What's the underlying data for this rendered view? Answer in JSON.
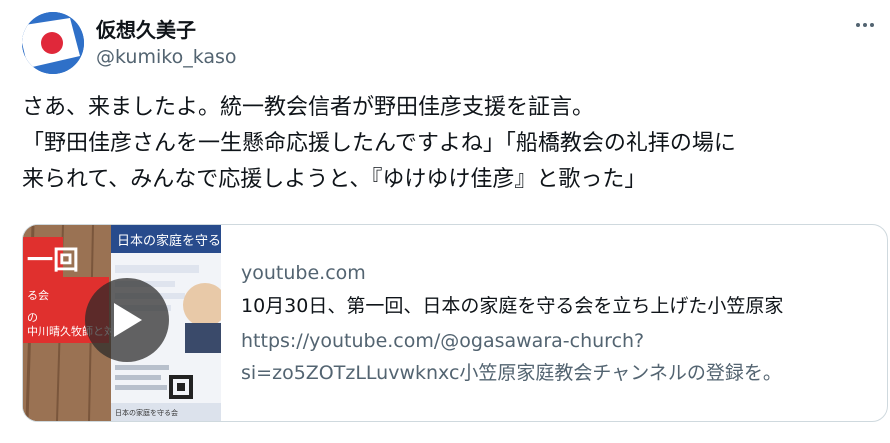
{
  "user": {
    "display_name": "仮想久美子",
    "handle": "@kumiko_kaso",
    "avatar_icon": "japan-flag-avatar"
  },
  "tweet": {
    "lines": [
      "さあ、来ましたよ。統一教会信者が野田佳彦支援を証言。",
      "「野田佳彦さんを一生懸命応援したんですよね」「船橋教会の礼拝の場に",
      "来られて、みんなで応援しようと、『ゆけゆけ佳彦』と歌った」"
    ]
  },
  "card": {
    "domain": "youtube.com",
    "title": "10月30日、第一回、日本の家庭を守る会を立ち上げた小笠原家",
    "description_lines": [
      "https://youtube.com/@ogasawara-church?",
      "si=zo5ZOTzLLuvwknxc小笠原家庭教会チャンネルの登録を。"
    ],
    "thumbnail": {
      "banner_text": "一回",
      "banner_sub1": "る会",
      "banner_sub2": "の",
      "banner_sub3": "中川晴久牧師と対",
      "poster_title": "日本の家庭を守る",
      "footer_text": "日本の家庭を守る会"
    }
  },
  "colors": {
    "text": "#0f1419",
    "secondary": "#536471",
    "border": "#cfd9de",
    "banner_red": "#e0302e"
  }
}
